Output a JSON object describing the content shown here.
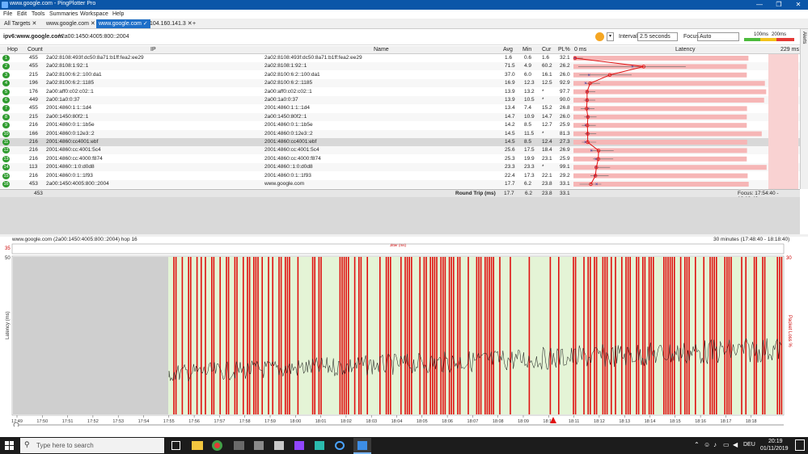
{
  "window": {
    "title": "www.google.com - PingPlotter Pro",
    "minimize": "—",
    "maximize": "❐",
    "close": "✕"
  },
  "menu": [
    "File",
    "Edit",
    "Tools",
    "Summaries",
    "Workspace",
    "Help"
  ],
  "tabs": [
    {
      "label": "All Targets",
      "close": "✕"
    },
    {
      "label": "www.google.com",
      "close": "✕"
    },
    {
      "label": "www.google.com",
      "close": "✓"
    },
    {
      "label": "104.160.141.3",
      "close": "✕"
    }
  ],
  "tab_add": "+",
  "toolbar": {
    "breadcrumb_bold": "ipv6:www.google.com",
    "breadcrumb_rest": "/ 2a00:1450:4005:800::2004",
    "interval_label": "Interval",
    "interval_value": "2.5 seconds",
    "focus_label": "Focus",
    "focus_value": "Auto",
    "legend_100": "100ms",
    "legend_200": "200ms",
    "alerts_label": "Alerts"
  },
  "table": {
    "columns": [
      "Hop",
      "Count",
      "IP",
      "Name",
      "Avg",
      "Min",
      "Cur",
      "PL%",
      "0 ms",
      "Latency",
      "229 ms"
    ],
    "rows": [
      {
        "hop": "1",
        "count": "455",
        "ip": "2a02:8108:493f:dc50:8a71:b1ff:fea2:ee29",
        "name": "2a02:8108:493f:dc50:8a71:b1ff:fea2:ee29",
        "avg": "1.6",
        "min": "0.6",
        "cur": "1.6",
        "pl": "32.1"
      },
      {
        "hop": "2",
        "count": "455",
        "ip": "2a02:8108:1:92::1",
        "name": "2a02:8108:1:92::1",
        "avg": "71.5",
        "min": "4.9",
        "cur": "60.2",
        "pl": "26.2"
      },
      {
        "hop": "3",
        "count": "215",
        "ip": "2a02:8100:6:2::100:da1",
        "name": "2a02:8100:6:2::100:da1",
        "avg": "37.0",
        "min": "6.0",
        "cur": "16.1",
        "pl": "26.0"
      },
      {
        "hop": "4",
        "count": "196",
        "ip": "2a02:8100:6:2::1185",
        "name": "2a02:8100:6:2::1185",
        "avg": "16.9",
        "min": "12.3",
        "cur": "12.5",
        "pl": "92.9"
      },
      {
        "hop": "5",
        "count": "176",
        "ip": "2a00:aff0:c02:c02::1",
        "name": "2a00:aff0:c02:c02::1",
        "avg": "13.9",
        "min": "13.2",
        "cur": "*",
        "pl": "97.7"
      },
      {
        "hop": "6",
        "count": "449",
        "ip": "2a00:1a0:0:37",
        "name": "2a00:1a0:0:37",
        "avg": "13.9",
        "min": "10.5",
        "cur": "*",
        "pl": "90.0"
      },
      {
        "hop": "7",
        "count": "455",
        "ip": "2001:4860:1:1::1d4",
        "name": "2001:4860:1:1::1d4",
        "avg": "13.4",
        "min": "7.4",
        "cur": "15.2",
        "pl": "26.8"
      },
      {
        "hop": "8",
        "count": "215",
        "ip": "2a00:1450:80f2::1",
        "name": "2a00:1450:80f2::1",
        "avg": "14.7",
        "min": "10.9",
        "cur": "14.7",
        "pl": "26.0"
      },
      {
        "hop": "9",
        "count": "216",
        "ip": "2001:4860:0:1::1b5e",
        "name": "2001:4860:0:1::1b5e",
        "avg": "14.2",
        "min": "8.5",
        "cur": "12.7",
        "pl": "25.9"
      },
      {
        "hop": "10",
        "count": "166",
        "ip": "2001:4860:0:12e3::2",
        "name": "2001:4860:0:12e3::2",
        "avg": "14.5",
        "min": "11.5",
        "cur": "*",
        "pl": "81.3"
      },
      {
        "hop": "11",
        "count": "216",
        "ip": "2001:4860:cc4001:ebf",
        "name": "2001:4860:cc4001:ebf",
        "avg": "14.5",
        "min": "8.5",
        "cur": "12.4",
        "pl": "27.3"
      },
      {
        "hop": "12",
        "count": "216",
        "ip": "2001:4860:cc:4001:5c4",
        "name": "2001:4860:cc:4001:5c4",
        "avg": "25.6",
        "min": "17.5",
        "cur": "18.4",
        "pl": "26.9"
      },
      {
        "hop": "13",
        "count": "216",
        "ip": "2001:4860:cc:4000:f874",
        "name": "2001:4860:cc:4000:f874",
        "avg": "25.3",
        "min": "19.9",
        "cur": "23.1",
        "pl": "25.9"
      },
      {
        "hop": "14",
        "count": "113",
        "ip": "2001:4860::1:0:d0d8",
        "name": "2001:4860::1:0:d0d8",
        "avg": "23.3",
        "min": "23.3",
        "cur": "*",
        "pl": "99.1"
      },
      {
        "hop": "15",
        "count": "216",
        "ip": "2001:4860:0:1::1f93",
        "name": "2001:4860:0:1::1f93",
        "avg": "22.4",
        "min": "17.3",
        "cur": "22.1",
        "pl": "29.2"
      },
      {
        "hop": "16",
        "count": "453",
        "ip": "2a00:1450:4005:800::2004",
        "name": "www.google.com",
        "avg": "17.7",
        "min": "6.2",
        "cur": "23.8",
        "pl": "33.1"
      }
    ],
    "summary": {
      "count": "453",
      "label": "Round Trip (ms)",
      "avg": "17.7",
      "min": "6.2",
      "cur": "23.8",
      "pl": "33.1",
      "focus": "Focus: 17:54:40 - 18:18:40"
    }
  },
  "graph": {
    "title": "www.google.com (2a00:1450:4005:800::2004) hop 16",
    "range": "30 minutes (17:48:40 - 18:18:40)",
    "jitter_label": "Jitter (ms)",
    "jitter_max": "35",
    "y_max": "50",
    "y_right_max": "30",
    "y_left_label": "Latency (ms)",
    "y_right_label": "Packet Loss %",
    "times": [
      "17:49",
      "17:50",
      "17:51",
      "17:52",
      "17:53",
      "17:54",
      "17:55",
      "17:56",
      "17:57",
      "17:58",
      "17:59",
      "18:00",
      "18:01",
      "18:02",
      "18:03",
      "18:04",
      "18:05",
      "18:06",
      "18:07",
      "18:08",
      "18:09",
      "18:10",
      "18:11",
      "18:12",
      "18:13",
      "18:14",
      "18:15",
      "18:16",
      "18:17",
      "18:18"
    ]
  },
  "chart_data": {
    "type": "line",
    "x_axis": "time",
    "xlim": [
      "17:48:40",
      "18:18:40"
    ],
    "ylim": [
      0,
      50
    ],
    "series": [
      {
        "name": "Latency (ms)",
        "note_range": [
          10,
          30
        ]
      },
      {
        "name": "Packet Loss %"
      }
    ]
  },
  "taskbar": {
    "search_placeholder": "Type here to search",
    "lang": "DEU",
    "time": "20:19",
    "date": "01/11/2019"
  },
  "colors": {
    "title_bar": "#0b56a8",
    "loss": "#e01010",
    "hop_ok": "#2e9b2e",
    "latency_bar": "#f6b6b6"
  }
}
